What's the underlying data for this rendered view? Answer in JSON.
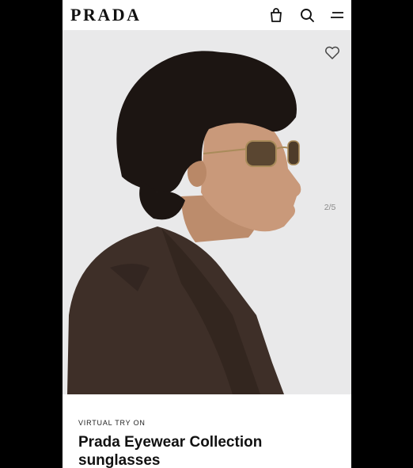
{
  "brand": {
    "logo_text": "PRADA"
  },
  "header": {
    "icons": [
      "bag-icon",
      "search-icon",
      "menu-icon"
    ]
  },
  "gallery": {
    "counter": "2/5",
    "wishlist_icon": "heart-icon"
  },
  "product": {
    "eyebrow": "VIRTUAL TRY ON",
    "title": "Prada Eyewear Collection sunglasses"
  },
  "colors": {
    "background": "#000000",
    "page": "#ffffff",
    "hero_backdrop": "#e9e9ea",
    "text": "#111111",
    "muted": "#8a8a8a"
  }
}
